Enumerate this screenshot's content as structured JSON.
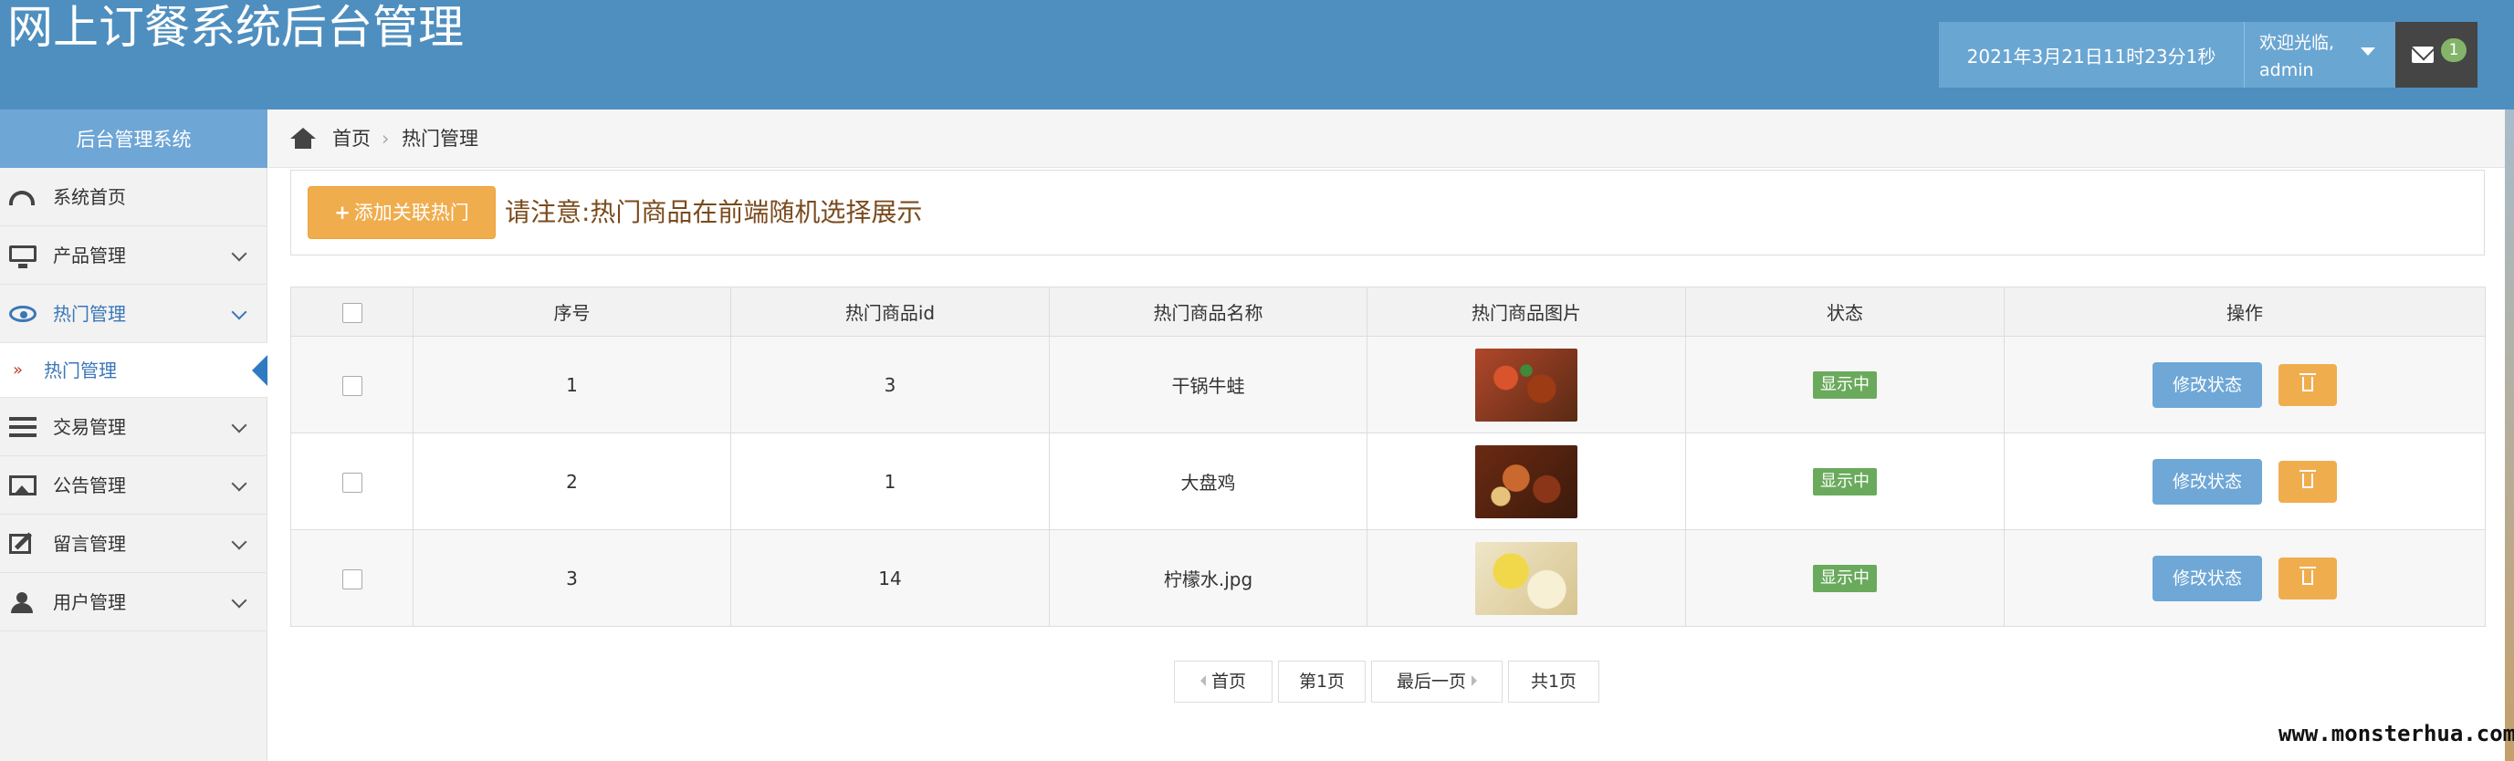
{
  "header": {
    "title": "网上订餐系统后台管理",
    "datetime": "2021年3月21日11时23分1秒",
    "welcome": "欢迎光临,",
    "username": "admin",
    "mail_count": "1"
  },
  "sidebar": {
    "title": "后台管理系统",
    "items": [
      {
        "label": "系统首页",
        "icon": "dashboard-icon"
      },
      {
        "label": "产品管理",
        "icon": "monitor-icon"
      },
      {
        "label": "热门管理",
        "icon": "eye-icon",
        "active": true
      },
      {
        "label": "交易管理",
        "icon": "list-icon"
      },
      {
        "label": "公告管理",
        "icon": "image-icon"
      },
      {
        "label": "留言管理",
        "icon": "edit-icon"
      },
      {
        "label": "用户管理",
        "icon": "users-icon"
      }
    ],
    "subitem": {
      "marker": "»",
      "label": "热门管理"
    }
  },
  "breadcrumb": {
    "home": "首页",
    "separator": "›",
    "current": "热门管理"
  },
  "notice": {
    "add_button": "添加关联热门",
    "text": "请注意:热门商品在前端随机选择展示"
  },
  "table": {
    "headers": [
      "序号",
      "热门商品id",
      "热门商品名称",
      "热门商品图片",
      "状态",
      "操作"
    ],
    "rows": [
      {
        "no": "1",
        "id": "3",
        "name": "干锅牛蛙",
        "image": "dish-photo",
        "status": "显示中"
      },
      {
        "no": "2",
        "id": "1",
        "name": "大盘鸡",
        "image": "dish-photo",
        "status": "显示中"
      },
      {
        "no": "3",
        "id": "14",
        "name": "柠檬水.jpg",
        "image": "drink-photo",
        "status": "显示中"
      }
    ],
    "edit_label": "修改状态"
  },
  "pagination": {
    "first": "首页",
    "page1": "第1页",
    "last": "最后一页",
    "total": "共1页"
  },
  "watermark": "www.monsterhua.com",
  "colors": {
    "header_bg": "#4f8fbf",
    "accent_blue": "#6ea6d6",
    "warning_orange": "#f0ad4e",
    "success_green": "#6aaa5c"
  }
}
